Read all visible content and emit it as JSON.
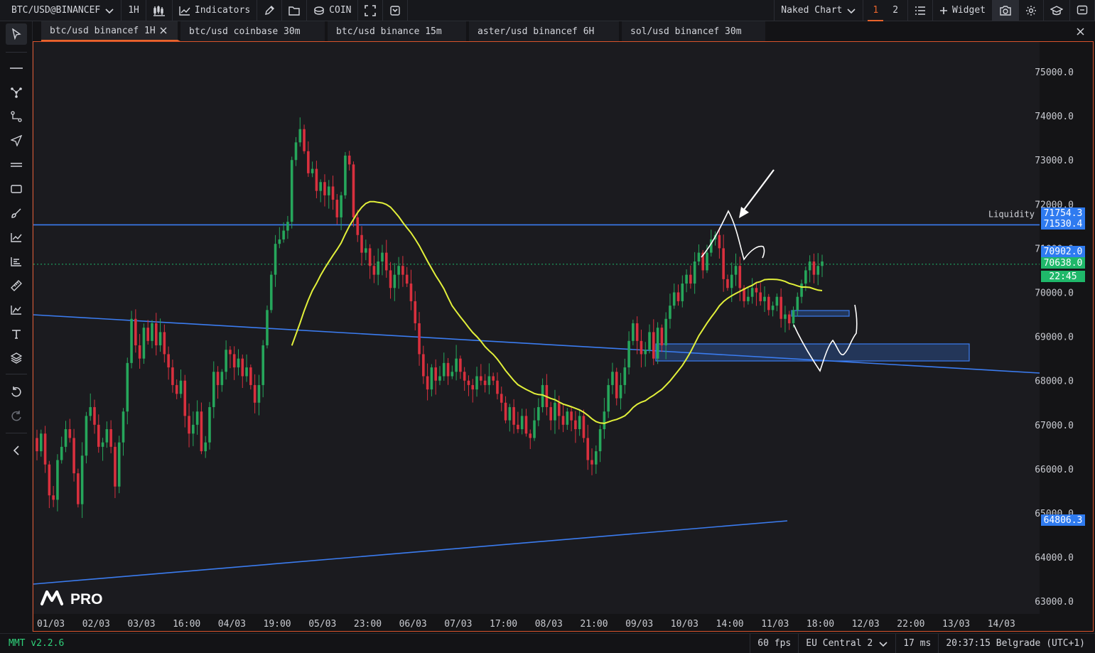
{
  "toolbar": {
    "symbol": "BTC/USD@BINANCEF",
    "timeframe": "1H",
    "indicators_label": "Indicators",
    "coin_label": "COIN",
    "template_label": "Naked Chart",
    "layout_1": "1",
    "layout_2": "2",
    "widget_label": "Widget"
  },
  "tabs": [
    {
      "label": "btc/usd binancef 1H",
      "active": true
    },
    {
      "label": "btc/usd coinbase 30m"
    },
    {
      "label": "btc/usd binance 15m"
    },
    {
      "label": "aster/usd binancef 6H"
    },
    {
      "label": "sol/usd binancef 30m"
    }
  ],
  "chart": {
    "logo_text": "PRO",
    "liquidity_label": "Liquidity",
    "price_axis": [
      "75000.0",
      "74000.0",
      "73000.0",
      "72000.0",
      "71000.0",
      "70000.0",
      "69000.0",
      "68000.0",
      "67000.0",
      "66000.0",
      "65000.0",
      "64000.0",
      "63000.0"
    ],
    "time_axis": [
      "01/03",
      "02/03",
      "03/03",
      "16:00",
      "04/03",
      "19:00",
      "05/03",
      "23:00",
      "06/03",
      "07/03",
      "17:00",
      "08/03",
      "21:00",
      "09/03",
      "10/03",
      "14:00",
      "11/03",
      "18:00",
      "12/03",
      "22:00",
      "13/03",
      "14/03"
    ],
    "price_tags": [
      {
        "text": "71754.3",
        "color": "#2f7bf0"
      },
      {
        "text": "71530.4",
        "color": "#2f7bf0"
      },
      {
        "text": "70902.0",
        "color": "#2f7bf0"
      },
      {
        "text": "70638.0",
        "color": "#1fb86a"
      },
      {
        "text": "22:45",
        "color": "#1fb86a"
      },
      {
        "text": "64806.3",
        "color": "#2f7bf0"
      }
    ],
    "colors": {
      "up": "#26a65b",
      "down": "#d9303e",
      "ma": "#e2f03a",
      "line": "#3b7cf0",
      "border": "#d9532b"
    }
  },
  "chart_data": {
    "type": "candlestick",
    "xlabel": "",
    "ylabel": "",
    "ylim": [
      62700,
      75500
    ],
    "closes": [
      66400,
      66800,
      66100,
      65400,
      65300,
      66200,
      66500,
      66900,
      66700,
      65900,
      65200,
      66300,
      67200,
      67400,
      67000,
      66500,
      66600,
      66900,
      66500,
      65600,
      66600,
      67300,
      68400,
      69400,
      68800,
      68500,
      69200,
      68900,
      69300,
      68800,
      69100,
      68600,
      68300,
      67900,
      67700,
      68000,
      67200,
      66800,
      67000,
      67300,
      66400,
      66600,
      67400,
      68200,
      67900,
      68200,
      68700,
      68600,
      68300,
      68500,
      68100,
      68300,
      67900,
      67500,
      67900,
      68800,
      69600,
      70400,
      71100,
      71200,
      71400,
      71600,
      73000,
      73400,
      73700,
      73200,
      72700,
      72800,
      72300,
      72500,
      72200,
      72400,
      72100,
      71700,
      72200,
      73100,
      72900,
      71700,
      71300,
      70900,
      71000,
      70600,
      70400,
      70700,
      70900,
      70500,
      70100,
      70400,
      70600,
      70400,
      70200,
      69800,
      69300,
      68600,
      68100,
      67800,
      68300,
      68000,
      68100,
      68400,
      68100,
      68200,
      68500,
      68200,
      68000,
      67900,
      67800,
      68100,
      68000,
      67900,
      68100,
      68000,
      67700,
      67500,
      67100,
      67400,
      67000,
      66900,
      67200,
      66800,
      66700,
      67100,
      67400,
      67900,
      67400,
      67100,
      67500,
      67200,
      67000,
      67300,
      67100,
      66900,
      67200,
      66700,
      66200,
      66100,
      66400,
      66900,
      67300,
      67900,
      68200,
      67600,
      67900,
      68300,
      68900,
      69300,
      68900,
      68600,
      68700,
      69100,
      68500,
      69200,
      68800,
      69400,
      69700,
      70000,
      69800,
      70200,
      70400,
      70200,
      70700,
      70900,
      70500,
      70900,
      71200,
      71300,
      71000,
      70300,
      70100,
      70400,
      70600,
      70100,
      69800,
      69900,
      70100,
      70000,
      69800,
      69900,
      69600,
      69700,
      69900,
      69400,
      69500,
      69300,
      69600,
      69900,
      70200,
      70500,
      70700,
      70400,
      70600,
      70700
    ]
  }
}
